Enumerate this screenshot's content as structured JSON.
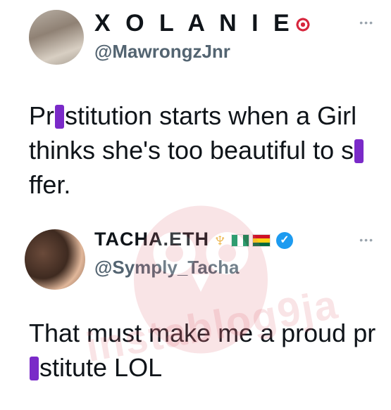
{
  "tweets": [
    {
      "name": "X O L A N I E",
      "handle": "@MawrongzJnr",
      "text_parts": [
        "Pr",
        "stitution starts when a Girl thinks she's too beautiful to s",
        "ffer."
      ],
      "more": "•••"
    },
    {
      "name": "TACHA.ETH",
      "handle": "@Symply_Tacha",
      "text_parts": [
        "That must make me a proud pr",
        "stitute LOL"
      ],
      "more": "•••"
    }
  ],
  "watermark": "instablog9ja",
  "colors": {
    "redaction": "#7a2ac8",
    "verified": "#1d9bf0",
    "handle": "#536471"
  }
}
